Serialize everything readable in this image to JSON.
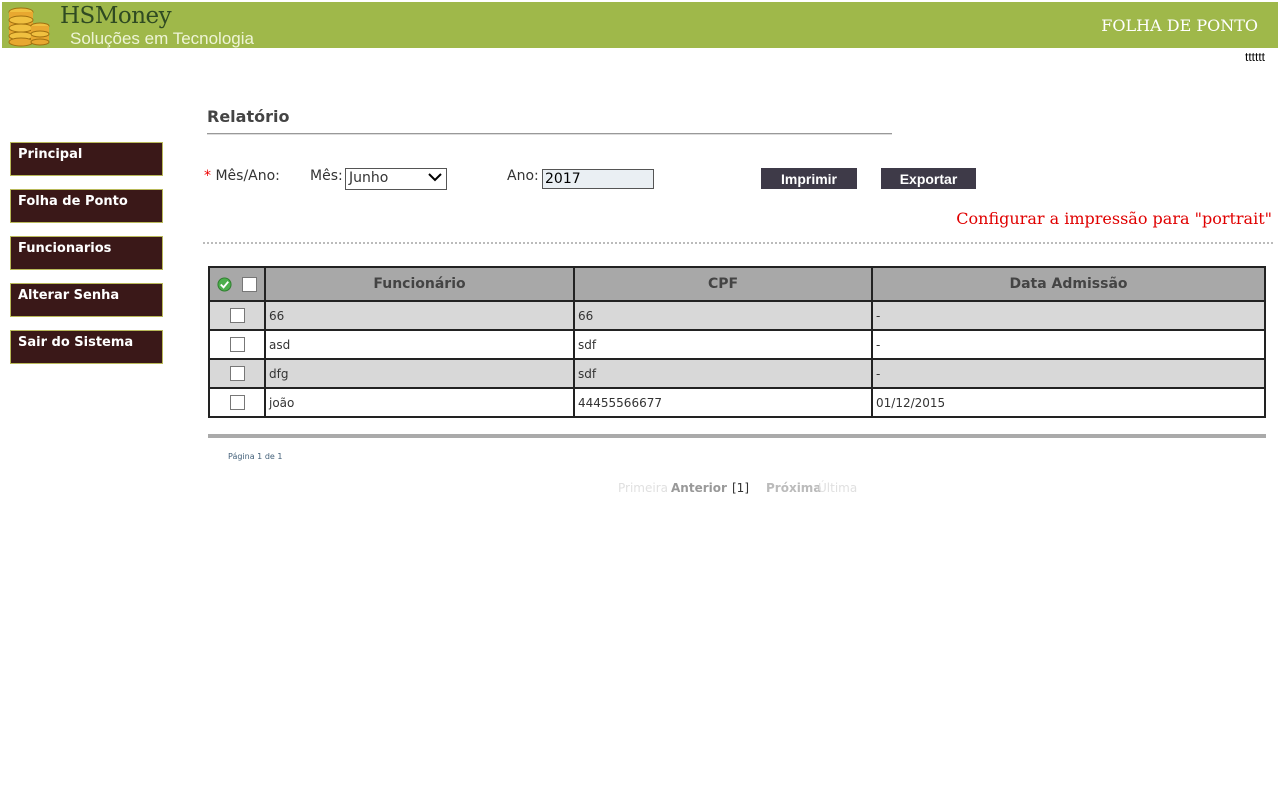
{
  "header": {
    "brand_name": "HSMoney",
    "brand_tagline": "Soluções em Tecnologia",
    "module_title": "FOLHA DE PONTO",
    "username": "tttttt",
    "bar_color": "#9fb84a"
  },
  "sidebar": {
    "items": [
      {
        "label": "Principal"
      },
      {
        "label": "Folha de Ponto"
      },
      {
        "label": "Funcionarios"
      },
      {
        "label": "Alterar Senha"
      },
      {
        "label": "Sair do Sistema"
      }
    ]
  },
  "report": {
    "title": "Relatório",
    "required_mark": "*",
    "mesano_label": "Mês/Ano:",
    "mes_label": "Mês:",
    "mes_value": "Junho",
    "ano_label": "Ano:",
    "ano_value": "2017",
    "print_button": "Imprimir",
    "export_button": "Exportar",
    "config_note": "Configurar a impressão para \"portrait\""
  },
  "table": {
    "columns": [
      "Funcionário",
      "CPF",
      "Data Admissão"
    ],
    "rows": [
      {
        "funcionario": "66",
        "cpf": "66",
        "admissao": "-"
      },
      {
        "funcionario": "asd",
        "cpf": "sdf",
        "admissao": "-"
      },
      {
        "funcionario": "dfg",
        "cpf": "sdf",
        "admissao": "-"
      },
      {
        "funcionario": "joão",
        "cpf": "44455566677",
        "admissao": "01/12/2015"
      }
    ]
  },
  "pagination": {
    "info": "Página 1 de 1",
    "first": "Primeira",
    "previous": "Anterior",
    "current": "[1]",
    "next": "Próxima",
    "last": "Última"
  },
  "icons": {
    "logo": "coin-stack-icon",
    "select_all": "check-circle-icon",
    "dropdown": "chevron-down-icon"
  }
}
